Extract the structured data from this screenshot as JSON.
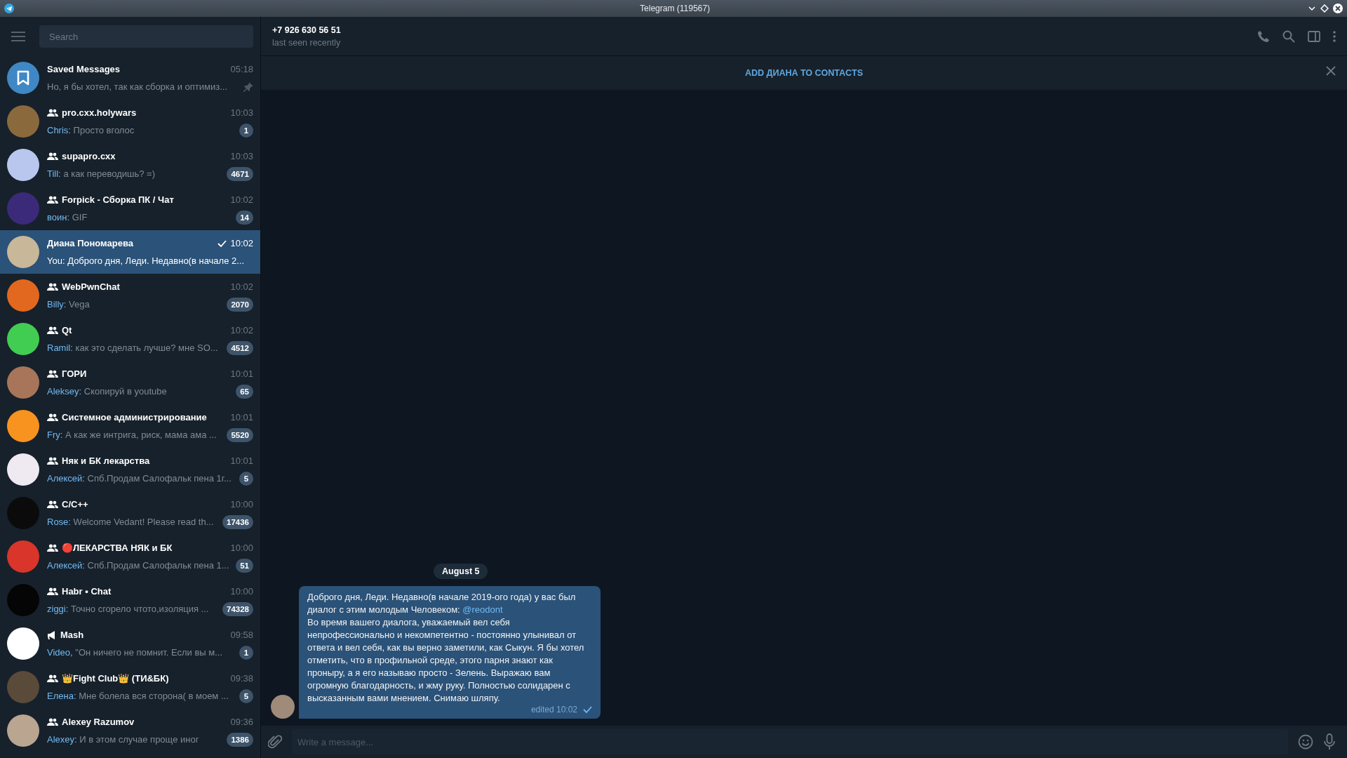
{
  "window": {
    "title": "Telegram (119567)"
  },
  "search": {
    "placeholder": "Search"
  },
  "chats": [
    {
      "kind": "saved",
      "name": "Saved Messages",
      "time": "05:18",
      "preview": "Но, я бы хотел, так как сборка и оптимиз...",
      "pinned": true,
      "sent": false,
      "selected": false,
      "color": "#3f88c5"
    },
    {
      "kind": "group",
      "name": "pro.cxx.holywars",
      "time": "10:03",
      "sender": "Chris:",
      "preview": "Просто вголос",
      "badge": "1",
      "pinned": false,
      "sent": false,
      "selected": false,
      "color": "#8a6a3c"
    },
    {
      "kind": "group",
      "name": "supapro.cxx",
      "time": "10:03",
      "sender": "Till:",
      "preview": "а как переводишь? =)",
      "badge": "4671",
      "pinned": false,
      "sent": false,
      "selected": false,
      "color": "#b9c7ef"
    },
    {
      "kind": "group",
      "name": "Forpick - Сборка ПК / Чат",
      "time": "10:02",
      "sender": "воин:",
      "preview": "GIF",
      "badge": "14",
      "pinned": false,
      "sent": false,
      "selected": false,
      "color": "#3b2a7a"
    },
    {
      "kind": "user",
      "name": "Диана Пономарева",
      "time": "10:02",
      "sender": "You:",
      "preview": "Доброго дня, Леди. Недавно(в начале 2...",
      "pinned": false,
      "sent": true,
      "selected": true,
      "color": "#c9b79a"
    },
    {
      "kind": "group",
      "name": "WebPwnChat",
      "time": "10:02",
      "sender": "Billy:",
      "preview": "Vega",
      "badge": "2070",
      "pinned": false,
      "sent": false,
      "selected": false,
      "color": "#e2681f"
    },
    {
      "kind": "group",
      "name": "Qt",
      "time": "10:02",
      "sender": "Ramil:",
      "preview": "как это сделать лучше? мне SO...",
      "badge": "4512",
      "pinned": false,
      "sent": false,
      "selected": false,
      "color": "#41cd52"
    },
    {
      "kind": "group",
      "name": "ГОРИ",
      "time": "10:01",
      "sender": "Aleksey:",
      "preview": "Скопируй в youtube",
      "badge": "65",
      "pinned": false,
      "sent": false,
      "selected": false,
      "color": "#a8755a"
    },
    {
      "kind": "group",
      "name": "Системное администрирование",
      "time": "10:01",
      "sender": "Fry:",
      "preview": "А как же интрига, риск, мама ама ...",
      "badge": "5520",
      "pinned": false,
      "sent": false,
      "selected": false,
      "color": "#f7931e"
    },
    {
      "kind": "group",
      "name": "Няк и БК лекарства",
      "time": "10:01",
      "sender": "Алексей:",
      "preview": "Спб.Продам Салофальк пена 1г...",
      "badge": "5",
      "pinned": false,
      "sent": false,
      "selected": false,
      "color": "#efeaf2"
    },
    {
      "kind": "group",
      "name": "C/C++",
      "time": "10:00",
      "sender": "Rose:",
      "preview": "Welcome Vedant! Please read th...",
      "badge": "17436",
      "pinned": false,
      "sent": false,
      "selected": false,
      "color": "#0b0b0b"
    },
    {
      "kind": "group",
      "name": "🔴ЛЕКАРСТВА НЯК и БК",
      "time": "10:00",
      "sender": "Алексей:",
      "preview": "Спб.Продам Салофальк пена 1...",
      "badge": "51",
      "pinned": false,
      "sent": false,
      "selected": false,
      "color": "#d9352a"
    },
    {
      "kind": "group",
      "name": "Habr • Chat",
      "time": "10:00",
      "sender": "ziggi:",
      "preview": "Точно сгорело чтото,изоляция ...",
      "badge": "74328",
      "pinned": false,
      "sent": false,
      "selected": false,
      "color": "#050505"
    },
    {
      "kind": "channel",
      "name": "Mash",
      "time": "09:58",
      "sender": "Video,",
      "preview": "\"Он ничего не помнит. Если вы м...",
      "badge": "1",
      "pinned": false,
      "sent": false,
      "selected": false,
      "color": "#ffffff"
    },
    {
      "kind": "group",
      "name": "👑Fight Club👑 (ТИ&БК)",
      "time": "09:38",
      "sender": "Елена:",
      "preview": "Мне болела вся сторона( в моем ...",
      "badge": "5",
      "pinned": false,
      "sent": false,
      "selected": false,
      "color": "#5a4a3a"
    },
    {
      "kind": "group",
      "name": "Alexey Razumov",
      "time": "09:36",
      "sender": "Alexey:",
      "preview": "И в этом случае проще иног",
      "badge": "1386",
      "pinned": false,
      "sent": false,
      "selected": false,
      "color": "#b9a590"
    }
  ],
  "chat_header": {
    "title": "+7 926 630 56 51",
    "status": "last seen recently"
  },
  "contact_bar": {
    "label": "ADD ДИАНА TO CONTACTS"
  },
  "date_badge": "August 5",
  "message": {
    "before": "Доброго дня, Леди. Недавно(в начале 2019-ого года) у вас был диалог с этим молодым Человеком: ",
    "link": "@reodont",
    "after": "\nВо время вашего диалога, уважаемый вел себя непрофессионально и некомпетентно - постоянно улынивал от ответа и вел себя, как вы верно заметили, как Сыкун. Я бы хотел отметить, что в профильной среде, этого парня знают как проныру, а я его называю просто - Зелень. Выражаю вам огромную благодарность, и жму руку. Полностью солидарен с высказанным вами мнением. Снимаю шляпу.",
    "meta": "edited 10:02",
    "sent": true
  },
  "composer": {
    "placeholder": "Write a message..."
  }
}
